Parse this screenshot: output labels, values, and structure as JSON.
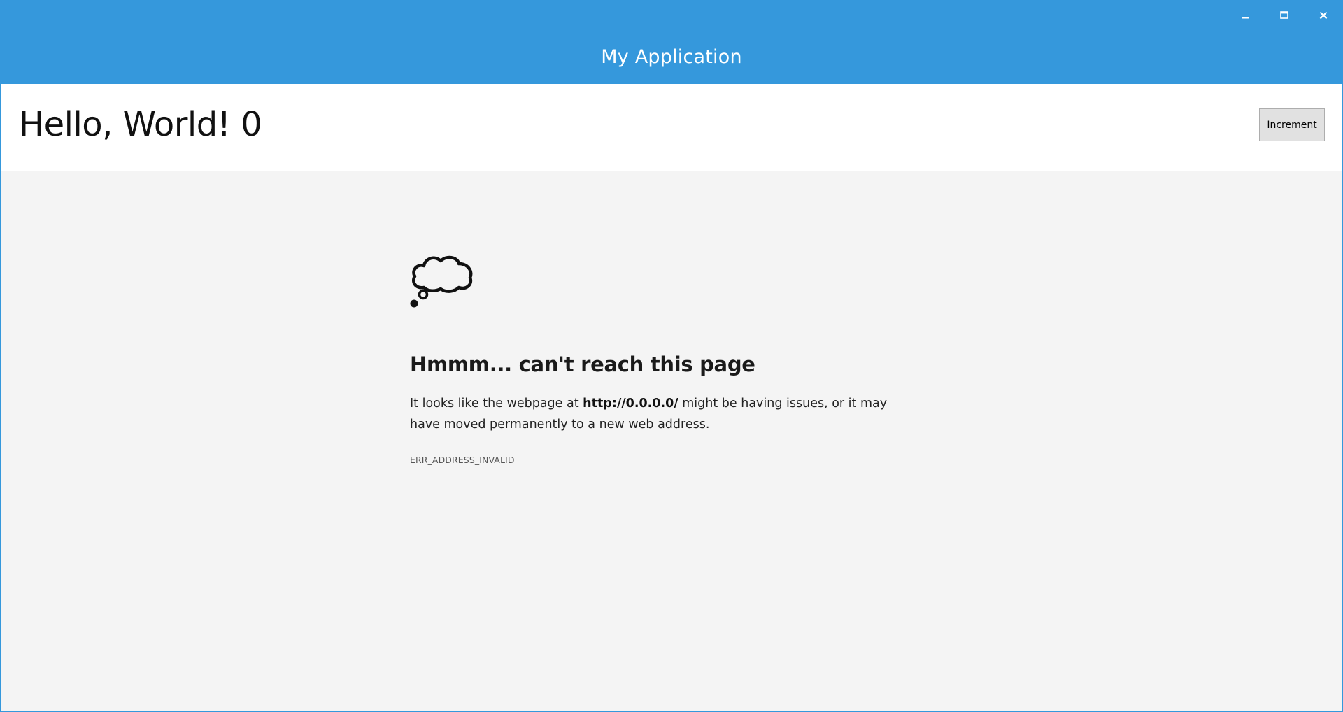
{
  "window": {
    "title": "My Application",
    "accent_color": "#3598dc",
    "controls": {
      "minimize_icon": "minimize-icon",
      "maximize_icon": "maximize-icon",
      "close_icon": "close-icon"
    }
  },
  "header": {
    "greeting": "Hello, World! 0",
    "increment_label": "Increment"
  },
  "error_page": {
    "icon": "thought-cloud-icon",
    "title": "Hmmm... can't reach this page",
    "desc_prefix": "It looks like the webpage at ",
    "url": "http://0.0.0.0/",
    "desc_suffix": " might be having issues, or it may have moved permanently to a new web address.",
    "error_code": "ERR_ADDRESS_INVALID"
  }
}
